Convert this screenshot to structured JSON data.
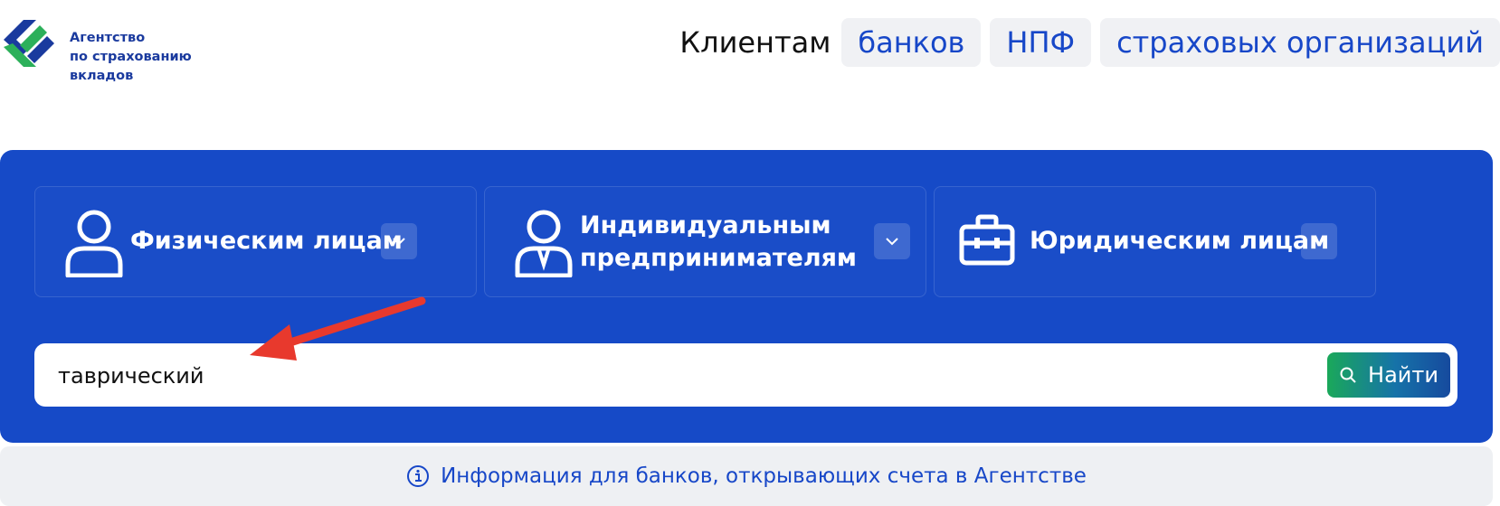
{
  "logo": {
    "line1": "Агентство",
    "line2": "по страхованию",
    "line3": "вкладов"
  },
  "nav": {
    "label": "Клиентам",
    "items": [
      {
        "label": "банков"
      },
      {
        "label": "НПФ"
      },
      {
        "label": "страховых организаций"
      }
    ]
  },
  "categories": [
    {
      "label": "Физическим лицам",
      "icon": "person-icon"
    },
    {
      "label_line1": "Индивидуальным",
      "label_line2": "предпринимателям",
      "icon": "entrepreneur-icon"
    },
    {
      "label": "Юридическим лицам",
      "icon": "briefcase-icon"
    }
  ],
  "search": {
    "value": "таврический",
    "button_label": "Найти"
  },
  "info_bar": {
    "text": "Информация для банков, открывающих счета в Агентстве"
  },
  "colors": {
    "brand_blue": "#164ac7",
    "link_blue": "#1747c8",
    "logo_green": "#2cb05a",
    "annotation_red": "#e8392d"
  }
}
